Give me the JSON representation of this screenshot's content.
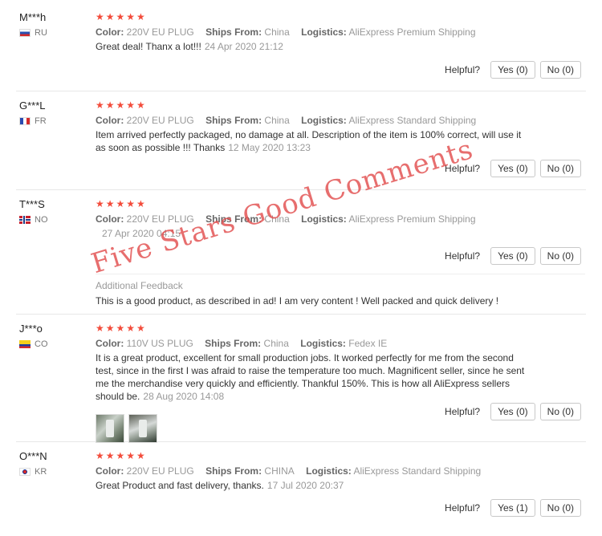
{
  "reviews": [
    {
      "user": "M***h",
      "country": "RU",
      "stars": "★★★★★",
      "color_label": "Color:",
      "color": "220V EU PLUG",
      "ships_label": "Ships From:",
      "ships": "China",
      "logistics_label": "Logistics:",
      "logistics": "AliExpress Premium Shipping",
      "text": "Great deal! Thanx a lot!!!",
      "date": "24 Apr 2020 21:12",
      "helpful_label": "Helpful?",
      "yes": "Yes (0)",
      "no": "No (0)"
    },
    {
      "user": "G***L",
      "country": "FR",
      "stars": "★★★★★",
      "color_label": "Color:",
      "color": "220V EU PLUG",
      "ships_label": "Ships From:",
      "ships": "China",
      "logistics_label": "Logistics:",
      "logistics": "AliExpress Standard Shipping",
      "text": "Item arrived perfectly packaged, no damage at all. Description of the item is 100% correct, will use it as soon as possible !!! Thanks",
      "date": "12 May 2020 13:23",
      "helpful_label": "Helpful?",
      "yes": "Yes (0)",
      "no": "No (0)"
    },
    {
      "user": "T***S",
      "country": "NO",
      "stars": "★★★★★",
      "color_label": "Color:",
      "color": "220V EU PLUG",
      "ships_label": "Ships From:",
      "ships": "China",
      "logistics_label": "Logistics:",
      "logistics": "AliExpress Premium Shipping",
      "date": "27 Apr 2020 04:15",
      "helpful_label": "Helpful?",
      "yes": "Yes (0)",
      "no": "No (0)",
      "additional_label": "Additional Feedback",
      "additional_text": "This is a good product, as described in ad! I am very content ! Well packed and quick delivery !"
    },
    {
      "user": "J***o",
      "country": "CO",
      "stars": "★★★★★",
      "color_label": "Color:",
      "color": "110V US PLUG",
      "ships_label": "Ships From:",
      "ships": "China",
      "logistics_label": "Logistics:",
      "logistics": "Fedex IE",
      "text": "It is a great product, excellent for small production jobs. It worked perfectly for me from the second test, since in the first I was afraid to raise the temperature too much. Magnificent seller, since he sent me the merchandise very quickly and efficiently. Thankful 150%. This is how all AliExpress sellers should be.",
      "date": "28 Aug 2020 14:08",
      "helpful_label": "Helpful?",
      "yes": "Yes (0)",
      "no": "No (0)"
    },
    {
      "user": "O***N",
      "country": "KR",
      "stars": "★★★★★",
      "color_label": "Color:",
      "color": "220V EU PLUG",
      "ships_label": "Ships From:",
      "ships": "CHINA",
      "logistics_label": "Logistics:",
      "logistics": "AliExpress Standard Shipping",
      "text": "Great Product and fast delivery, thanks.",
      "date": "17 Jul 2020 20:37",
      "helpful_label": "Helpful?",
      "yes": "Yes (1)",
      "no": "No (0)"
    }
  ],
  "watermark": "Five Stars Good Comments",
  "colors": {
    "stars": "#f34b3a",
    "watermark": "#e24e4e"
  },
  "flags": [
    "flag-ru-icon",
    "flag-fr-icon",
    "flag-no-icon",
    "flag-co-icon",
    "flag-kr-icon"
  ]
}
